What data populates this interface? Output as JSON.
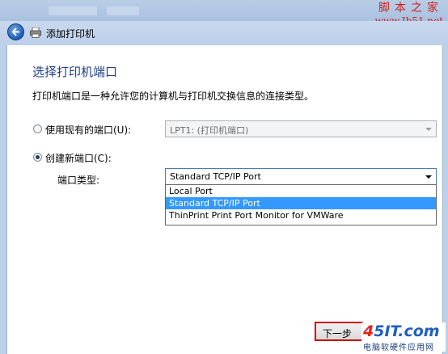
{
  "watermark": {
    "top": "脚本之家",
    "url": "www.Jb51.net"
  },
  "nav": {
    "title": "添加打印机"
  },
  "page": {
    "heading": "选择打印机端口",
    "description": "打印机端口是一种允许您的计算机与打印机交换信息的连接类型。"
  },
  "existing_port": {
    "label": "使用现有的端口(U):",
    "selected": false,
    "value": "LPT1: (打印机端口)"
  },
  "new_port": {
    "label": "创建新端口(C):",
    "selected": true,
    "type_label": "端口类型:",
    "value": "Standard TCP/IP Port",
    "options": [
      "Local Port",
      "Standard TCP/IP Port",
      "ThinPrint Print Port Monitor for VMWare"
    ],
    "highlighted_index": 1
  },
  "buttons": {
    "next": "下一步"
  },
  "logo": {
    "brand_a": "4",
    "brand_b": "5IT",
    "brand_c": ".com",
    "subtitle": "电脑软硬件应用网"
  }
}
